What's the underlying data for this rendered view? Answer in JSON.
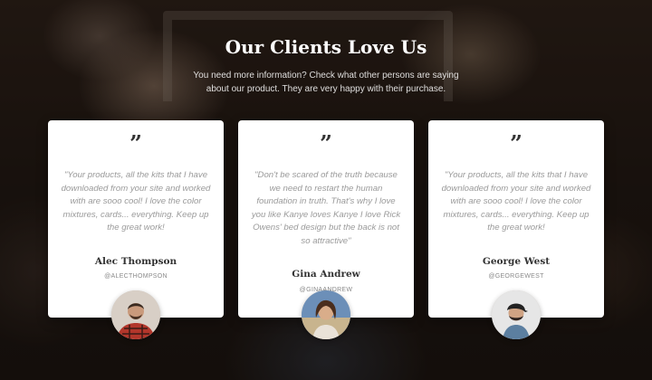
{
  "header": {
    "title": "Our Clients Love Us",
    "subtitle": "You need more information? Check what other persons are saying about our product. They are very happy with their purchase."
  },
  "testimonials": [
    {
      "quote_icon": "”",
      "text": "\"Your products, all the kits that I have downloaded from your site and worked with are sooo cool! I love the color mixtures, cards... everything. Keep up the great work!",
      "name": "Alec Thompson",
      "handle": "@ALECTHOMPSON"
    },
    {
      "quote_icon": "”",
      "text": "\"Don't be scared of the truth because we need to restart the human foundation in truth. That's why I love you like Kanye loves Kanye I love Rick Owens' bed design but the back is not so attractive\"",
      "name": "Gina Andrew",
      "handle": "@GINAANDREW"
    },
    {
      "quote_icon": "”",
      "text": "\"Your products, all the kits that I have downloaded from your site and worked with are sooo cool! I love the color mixtures, cards... everything. Keep up the great work!",
      "name": "George West",
      "handle": "@GEORGEWEST"
    }
  ]
}
